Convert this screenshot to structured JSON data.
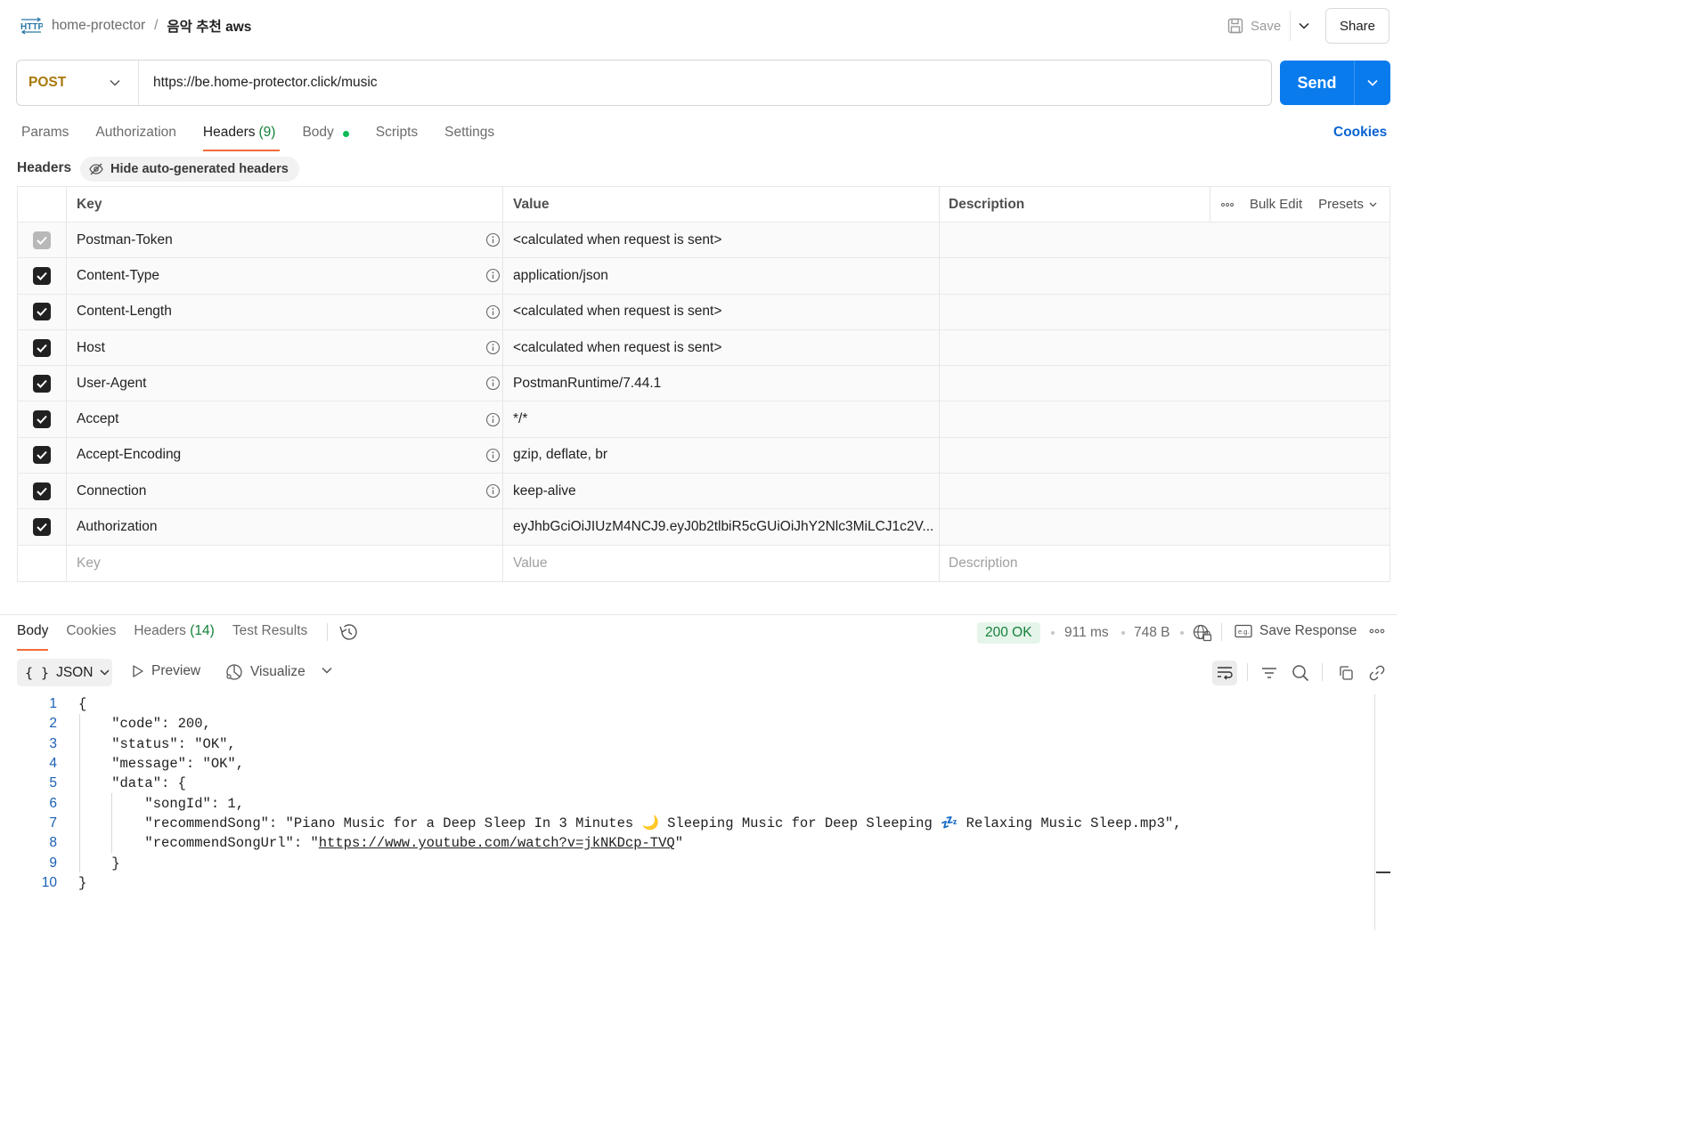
{
  "breadcrumb": {
    "collection": "home-protector",
    "separator": "/",
    "request": "음악 추천 aws"
  },
  "toolbar": {
    "save_label": "Save",
    "share_label": "Share"
  },
  "request": {
    "method": "POST",
    "url": "https://be.home-protector.click/music",
    "send_label": "Send"
  },
  "request_tabs": {
    "params": "Params",
    "authorization": "Authorization",
    "headers": "Headers",
    "headers_count": "(9)",
    "body": "Body",
    "scripts": "Scripts",
    "settings": "Settings",
    "cookies": "Cookies"
  },
  "headers_section": {
    "title": "Headers",
    "hide_auto": "Hide auto-generated headers"
  },
  "headers_table": {
    "columns": {
      "key": "Key",
      "value": "Value",
      "description": "Description"
    },
    "tools": {
      "bulk_edit": "Bulk Edit",
      "presets": "Presets"
    },
    "rows": [
      {
        "key": "Postman-Token",
        "value": "<calculated when request is sent>",
        "checked": true,
        "disabled": true
      },
      {
        "key": "Content-Type",
        "value": "application/json",
        "checked": true
      },
      {
        "key": "Content-Length",
        "value": "<calculated when request is sent>",
        "checked": true
      },
      {
        "key": "Host",
        "value": "<calculated when request is sent>",
        "checked": true
      },
      {
        "key": "User-Agent",
        "value": "PostmanRuntime/7.44.1",
        "checked": true
      },
      {
        "key": "Accept",
        "value": "*/*",
        "checked": true
      },
      {
        "key": "Accept-Encoding",
        "value": "gzip, deflate, br",
        "checked": true
      },
      {
        "key": "Connection",
        "value": "keep-alive",
        "checked": true
      },
      {
        "key": "Authorization",
        "value": "eyJhbGciOiJIUzM4NCJ9.eyJ0b2tlbiR5cGUiOiJhY2Nlc3MiLCJ1c2V...",
        "checked": true
      }
    ],
    "placeholders": {
      "key": "Key",
      "value": "Value",
      "description": "Description"
    }
  },
  "response_tabs": {
    "body": "Body",
    "cookies": "Cookies",
    "headers": "Headers",
    "headers_count": "(14)",
    "test_results": "Test Results"
  },
  "response_meta": {
    "status": "200 OK",
    "time": "911 ms",
    "size": "748 B",
    "save_response": "Save Response"
  },
  "response_view": {
    "format": "JSON",
    "preview": "Preview",
    "visualize": "Visualize"
  },
  "response_body": {
    "line_numbers": [
      "1",
      "2",
      "3",
      "4",
      "5",
      "6",
      "7",
      "8",
      "9",
      "10"
    ],
    "lines": [
      "{",
      "    \"code\": 200,",
      "    \"status\": \"OK\",",
      "    \"message\": \"OK\",",
      "    \"data\": {",
      "        \"songId\": 1,",
      "        \"recommendSong\": \"Piano Music for a Deep Sleep In 3 Minutes 🌙 Sleeping Music for Deep Sleeping 💤 Relaxing Music Sleep.mp3\",",
      "        \"recommendSongUrl\": \"",
      "    }",
      "}"
    ],
    "url_link": "https://www.youtube.com/watch?v=jkNKDcp-TVQ",
    "url_suffix": "\""
  },
  "icons": [
    "http-icon",
    "save-icon",
    "chevron-down-icon",
    "hide-eye-icon",
    "info-icon",
    "check-icon",
    "more-icon",
    "history-icon",
    "globe-lock-icon",
    "save-response-icon",
    "braces-icon",
    "play-icon",
    "visualize-icon",
    "wrap-icon",
    "filter-icon",
    "search-icon",
    "copy-icon",
    "link-icon"
  ],
  "colors": {
    "accent_blue": "#097bed",
    "method": "#a9780a",
    "tab_underline": "#f26b3a",
    "status_green": "#14813a",
    "dot_green": "#0cbb52"
  }
}
